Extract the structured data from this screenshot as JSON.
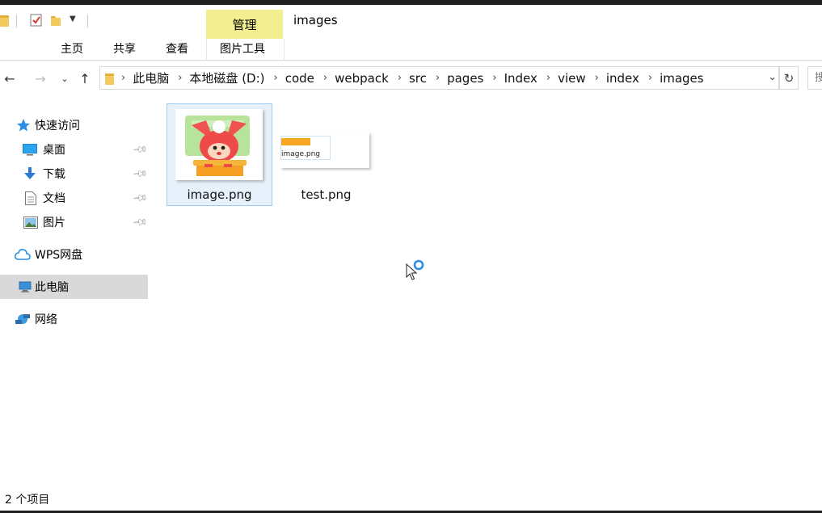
{
  "ribbon": {
    "context_tab": "管理",
    "context_group": "图片工具",
    "tabs": [
      "主页",
      "共享",
      "查看"
    ],
    "window_title": "images"
  },
  "address": {
    "crumbs": [
      "此电脑",
      "本地磁盘 (D:)",
      "code",
      "webpack",
      "src",
      "pages",
      "Index",
      "view",
      "index",
      "images"
    ],
    "search_placeholder": "搜"
  },
  "sidebar": {
    "quick_access": "快速访问",
    "pinned": [
      "桌面",
      "下载",
      "文档",
      "图片"
    ],
    "wps": "WPS网盘",
    "this_pc": "此电脑",
    "network": "网络"
  },
  "files": [
    {
      "name": "image.png",
      "selected": true
    },
    {
      "name": "test.png",
      "selected": false,
      "thumb_caption": "image.png"
    }
  ],
  "status": {
    "count": "2 个项目"
  },
  "colors": {
    "context_tab_bg": "#f3ee8f",
    "selection_bg": "#e6f1fb",
    "selection_border": "#9ccdf0",
    "sidebar_selected": "#d9d9d9"
  }
}
